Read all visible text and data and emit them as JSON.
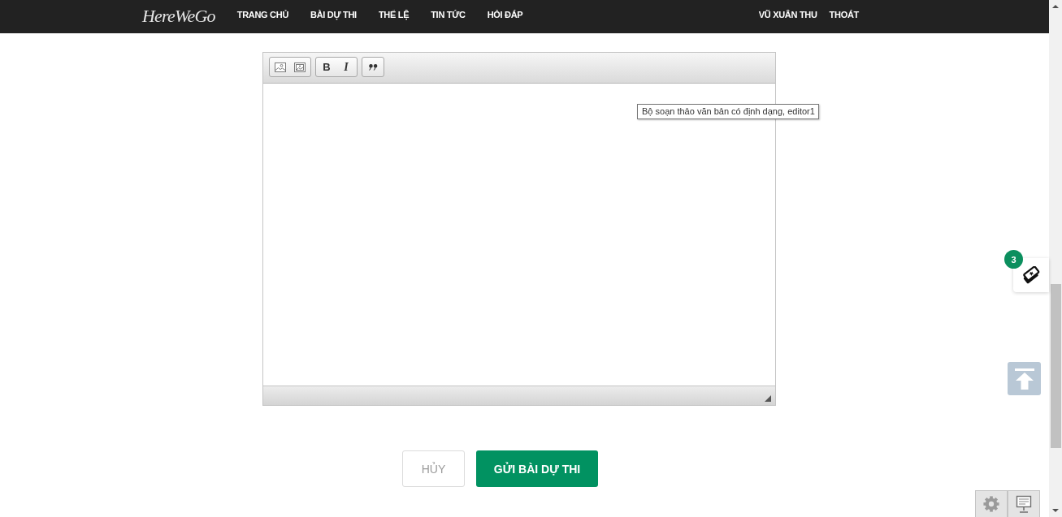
{
  "nav": {
    "logo": "HereWeGo",
    "items": [
      {
        "label": "TRANG CHỦ"
      },
      {
        "label": "BÀI DỰ THI"
      },
      {
        "label": "THỂ LỆ"
      },
      {
        "label": "TIN TỨC"
      },
      {
        "label": "HỎI ĐÁP"
      }
    ],
    "user": "VŨ XUÂN THU",
    "logout": "THOÁT"
  },
  "editor": {
    "toolbar_groups": [
      {
        "buttons": [
          {
            "kind": "image"
          },
          {
            "kind": "image-button"
          }
        ]
      },
      {
        "buttons": [
          {
            "kind": "bold",
            "label": "B"
          },
          {
            "kind": "italic",
            "label": "I"
          }
        ]
      },
      {
        "buttons": [
          {
            "kind": "blockquote"
          }
        ]
      }
    ],
    "tooltip": "Bộ soạn thảo văn bản có định dạng, editor1"
  },
  "actions": [
    {
      "kind": "secondary",
      "label": "HỦY"
    },
    {
      "kind": "primary",
      "label": "GỬI BÀI DỰ THI"
    }
  ],
  "ticket_widget": {
    "count": "3"
  }
}
